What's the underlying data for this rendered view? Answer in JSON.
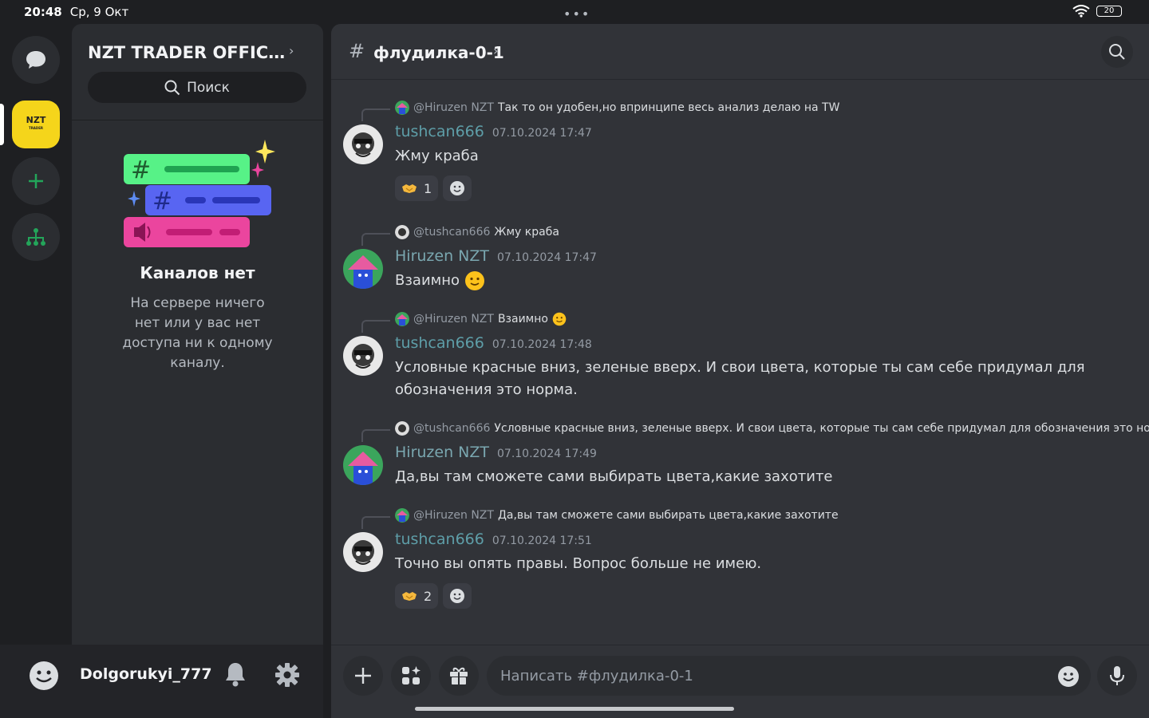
{
  "status": {
    "time": "20:48",
    "date": "Ср, 9 Окт",
    "battery": "20"
  },
  "rail": {
    "server_logo_text": "NZT",
    "server_logo_sub": "TRADER"
  },
  "server": {
    "name": "NZT TRADER OFFICIA...",
    "search_label": "Поиск"
  },
  "empty": {
    "title": "Каналов нет",
    "text": "На сервере ничего нет или у вас нет доступа ни к одному каналу."
  },
  "user": {
    "name": "Dolgorukyi_777"
  },
  "channel": {
    "title": "флудилка-0-1"
  },
  "messages": [
    {
      "reply_mention": "@Hiruzen NZT",
      "reply_text": "Так то он удобен,но впринципе весь анализ делаю на TW",
      "author": "tushcan666",
      "time": "07.10.2024 17:47",
      "text": "Жму краба",
      "reaction_count": "1"
    },
    {
      "reply_mention": "@tushcan666",
      "reply_text": "Жму краба",
      "author": "Hiruzen NZT",
      "time": "07.10.2024 17:47",
      "text": "Взаимно"
    },
    {
      "reply_mention": "@Hiruzen NZT",
      "reply_text": "Взаимно",
      "author": "tushcan666",
      "time": "07.10.2024 17:48",
      "text": "Условные красные вниз, зеленые вверх. И свои цвета, которые ты сам себе придумал для обозначения это норма."
    },
    {
      "reply_mention": "@tushcan666",
      "reply_text": "Условные красные вниз, зеленые вверх. И свои цвета, которые ты сам себе придумал для обозначения это норма.",
      "author": "Hiruzen NZT",
      "time": "07.10.2024 17:49",
      "text": "Да,вы там сможете сами выбирать цвета,какие захотите"
    },
    {
      "reply_mention": "@Hiruzen NZT",
      "reply_text": "Да,вы там сможете сами выбирать цвета,какие захотите",
      "author": "tushcan666",
      "time": "07.10.2024 17:51",
      "text": "Точно вы опять правы. Вопрос больше не имею.",
      "reaction_count": "2"
    }
  ],
  "composer": {
    "placeholder": "Написать #флудилка-0-1"
  }
}
